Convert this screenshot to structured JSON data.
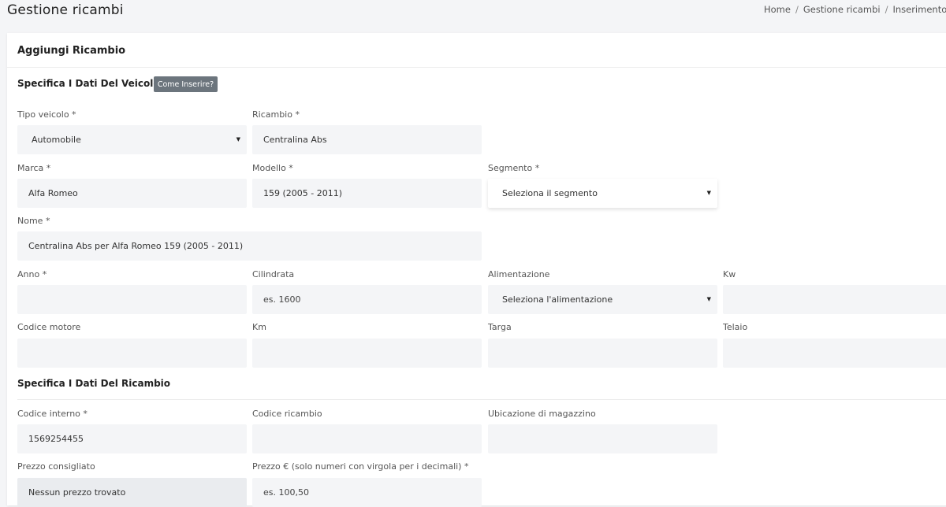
{
  "header": {
    "title": "Gestione ricambi",
    "breadcrumb": [
      "Home",
      "Gestione ricambi",
      "Inserimento ricam"
    ]
  },
  "card": {
    "title": "Aggiungi Ricambio",
    "vehicle_section": {
      "title": "Specifica I Dati Del Veicolo",
      "help_button": "Come Inserire?"
    },
    "part_section": {
      "title": "Specifica I Dati Del Ricambio"
    }
  },
  "fields": {
    "tipo_veicolo": {
      "label": "Tipo veicolo *",
      "value": "Automobile"
    },
    "ricambio": {
      "label": "Ricambio *",
      "value": "Centralina Abs"
    },
    "marca": {
      "label": "Marca *",
      "value": "Alfa Romeo"
    },
    "modello": {
      "label": "Modello *",
      "value": "159 (2005 - 2011)"
    },
    "segmento": {
      "label": "Segmento *",
      "value": "Seleziona il segmento"
    },
    "nome": {
      "label": "Nome *",
      "value": "Centralina Abs per Alfa Romeo 159 (2005 - 2011)"
    },
    "anno": {
      "label": "Anno *",
      "value": ""
    },
    "cilindrata": {
      "label": "Cilindrata",
      "placeholder": "es. 1600"
    },
    "alimentazione": {
      "label": "Alimentazione",
      "value": "Seleziona l'alimentazione"
    },
    "kw": {
      "label": "Kw",
      "value": ""
    },
    "codice_motore": {
      "label": "Codice motore",
      "value": ""
    },
    "km": {
      "label": "Km",
      "value": ""
    },
    "targa": {
      "label": "Targa",
      "value": ""
    },
    "telaio": {
      "label": "Telaio",
      "value": ""
    },
    "codice_interno": {
      "label": "Codice interno *",
      "value": "1569254455"
    },
    "codice_ricambio": {
      "label": "Codice ricambio",
      "value": ""
    },
    "ubicazione": {
      "label": "Ubicazione di magazzino",
      "value": ""
    },
    "prezzo_consigliato": {
      "label": "Prezzo consigliato",
      "value": "Nessun prezzo trovato"
    },
    "prezzo": {
      "label": "Prezzo € (solo numeri con virgola per i decimali) *",
      "placeholder": "es. 100,50"
    }
  },
  "colors": {
    "field_bg": "#f4f5f7",
    "help_button_bg": "#6c757d"
  }
}
